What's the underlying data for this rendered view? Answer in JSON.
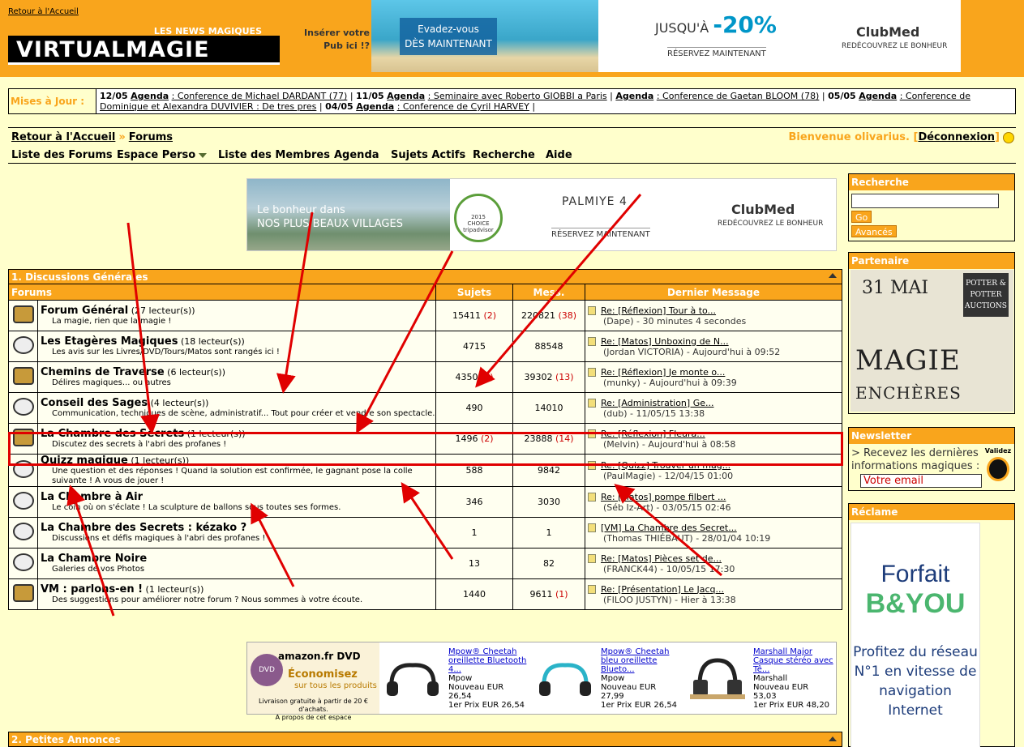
{
  "header": {
    "home_link": "Retour à l'Accueil",
    "logo_tagline": "LES NEWS MAGIQUES",
    "logo_word": "VIRTUALMAGIE",
    "pub_line1": "Insérer votre",
    "pub_line2": "Pub ici !?",
    "ad": {
      "line1": "Evadez-vous",
      "line2": "DÈS MAINTENANT",
      "promo_prefix": "JUSQU'À",
      "promo_value": "-20%",
      "reserve": "RÉSERVEZ MAINTENANT",
      "brand": "ClubMed",
      "brand_sub": "REDÉCOUVREZ LE BONHEUR"
    }
  },
  "updates": {
    "label": "Mises à Jour :",
    "items": [
      {
        "date": "12/05",
        "cat": "Agenda",
        "text": ": Conference de Michael DARDANT (77)"
      },
      {
        "date": "11/05",
        "cat": "Agenda",
        "text": ": Seminaire avec Roberto GIOBBI a Paris"
      },
      {
        "date": "",
        "cat": "Agenda",
        "text": ": Conference de Gaetan BLOOM (78)"
      },
      {
        "date": "05/05",
        "cat": "Agenda",
        "text": ": Conference de Dominique et Alexandra DUVIVIER : De tres pres"
      },
      {
        "date": "04/05",
        "cat": "Agenda",
        "text": ": Conference de Cyril HARVEY"
      }
    ]
  },
  "breadcrumb": {
    "home": "Retour à l'Accueil",
    "sep": "»",
    "forums": "Forums",
    "welcome": "Bienvenue olivarius.",
    "logout": "Déconnexion"
  },
  "menu": [
    "Liste des Forums",
    "Espace Perso",
    "Liste des Membres",
    "Agenda",
    "Sujets Actifs",
    "Recherche",
    "Aide"
  ],
  "mid_ad": {
    "photo_line1": "Le bonheur dans",
    "photo_line2": "NOS PLUS BEAUX VILLAGES",
    "badge": "tripadvisor",
    "badge_top": "2015",
    "badge_mid": "CHOICE",
    "village": "PALMIYE 4",
    "reserve": "RÉSERVEZ MAINTENANT",
    "brand": "ClubMed",
    "brand_sub": "REDÉCOUVREZ LE BONHEUR"
  },
  "forum_table": {
    "category_title": "1. Discussions Générales",
    "columns": [
      "Forums",
      "Sujets",
      "Mess.",
      "Dernier Message"
    ],
    "rows": [
      {
        "title": "Forum Général",
        "readers": "(27 lecteur(s))",
        "desc": "La magie, rien que la magie !",
        "topics": "15411",
        "topics_new": "(2)",
        "posts": "220821",
        "posts_new": "(38)",
        "last_title": "Re: [Réflexion] Tour à to...",
        "last_meta": "(Dape) - 30 minutes 4 secondes",
        "hot": true
      },
      {
        "title": "Les Etagères Magiques",
        "readers": "(18 lecteur(s))",
        "desc": "Les avis sur les Livres/DVD/Tours/Matos sont rangés ici !",
        "topics": "4715",
        "topics_new": "",
        "posts": "88548",
        "posts_new": "",
        "last_title": "Re: [Matos] Unboxing de N...",
        "last_meta": "(Jordan VICTORIA) - Aujourd'hui à 09:52",
        "hot": false
      },
      {
        "title": "Chemins de Traverse",
        "readers": "(6 lecteur(s))",
        "desc": "Délires magiques... ou autres",
        "topics": "4350",
        "topics_new": "(1)",
        "posts": "39302",
        "posts_new": "(13)",
        "last_title": "Re: [Réflexion] Je monte o...",
        "last_meta": "(munky) - Aujourd'hui à 09:39",
        "hot": true
      },
      {
        "title": "Conseil des Sages",
        "readers": "(4 lecteur(s))",
        "desc": "Communication, techniques de scène, administratif... Tout pour créer et vendre son spectacle.",
        "topics": "490",
        "topics_new": "",
        "posts": "14010",
        "posts_new": "",
        "last_title": "Re: [Administration] Ge...",
        "last_meta": "(dub) - 11/05/15 13:38",
        "hot": false
      },
      {
        "title": "La Chambre des Secrets",
        "readers": "(1 lecteur(s))",
        "desc": "Discutez des secrets à l'abri des profanes !",
        "topics": "1496",
        "topics_new": "(2)",
        "posts": "23888",
        "posts_new": "(14)",
        "last_title": "Re: [Réflexion] Fleura...",
        "last_meta": "(Melvin) - Aujourd'hui à 08:58",
        "hot": true
      },
      {
        "title": "Quizz magique",
        "readers": "(1 lecteur(s))",
        "desc": "Une question et des réponses ! Quand la solution est confirmée, le gagnant pose la colle suivante ! A vous de jouer !",
        "topics": "588",
        "topics_new": "",
        "posts": "9842",
        "posts_new": "",
        "last_title": "Re: [Quizz] Trouver un mag...",
        "last_meta": "(PaulMagie) - 12/04/15 01:00",
        "hot": false
      },
      {
        "title": "La Chambre à Air",
        "readers": "",
        "desc": "Le coin où on s'éclate ! La sculpture de ballons sous toutes ses formes.",
        "topics": "346",
        "topics_new": "",
        "posts": "3030",
        "posts_new": "",
        "last_title": "Re: [Matos] pompe filbert ...",
        "last_meta": "(Séb Iz-Art) - 03/05/15 02:46",
        "hot": false
      },
      {
        "title": "La Chambre des Secrets : kézako ?",
        "readers": "",
        "desc": "Discussions et défis magiques à l'abri des profanes !",
        "topics": "1",
        "topics_new": "",
        "posts": "1",
        "posts_new": "",
        "last_title": "[VM] La Chambre des Secret...",
        "last_meta": "(Thomas THIÉBAUT) - 28/01/04 10:19",
        "hot": false
      },
      {
        "title": "La Chambre Noire",
        "readers": "",
        "desc": "Galeries de vos Photos",
        "topics": "13",
        "topics_new": "",
        "posts": "82",
        "posts_new": "",
        "last_title": "Re: [Matos] Pièces set de...",
        "last_meta": "(FRANCK44) - 10/05/15 17:30",
        "hot": false
      },
      {
        "title": "VM : parlons-en !",
        "readers": "(1 lecteur(s))",
        "desc": "Des suggestions pour améliorer notre forum ? Nous sommes à votre écoute.",
        "topics": "1440",
        "topics_new": "",
        "posts": "9611",
        "posts_new": "(1)",
        "last_title": "Re: [Présentation] Le Jacq...",
        "last_meta": "(FILOO JUSTYN) - Hier à 13:38",
        "hot": true
      }
    ]
  },
  "amazon": {
    "logo": "amazon.fr DVD",
    "dvd": "DVD",
    "eco": "Économisez",
    "eco2": "sur tous les produits",
    "fine1": "Livraison gratuite à partir de 20 € d'achats.",
    "fine2": "A propos de cet espace",
    "products": [
      {
        "title": "Mpow® Cheetah oreillette Bluetooth 4...",
        "seller": "Mpow",
        "new_label": "Nouveau EUR",
        "price": "26,54",
        "first": "1er Prix EUR 26,54"
      },
      {
        "title": "Mpow® Cheetah bleu oreillette Blueto...",
        "seller": "Mpow",
        "new_label": "Nouveau EUR",
        "price": "27,99",
        "first": "1er Prix EUR 26,54"
      },
      {
        "title": "Marshall Major Casque stéréo avec Tê...",
        "seller": "Marshall",
        "new_label": "Nouveau EUR",
        "price": "53,03",
        "first": "1er Prix EUR 48,20"
      }
    ]
  },
  "category2": "2. Petites Annonces",
  "sidebar": {
    "search": {
      "title": "Recherche",
      "go": "Go",
      "advanced": "Avancés"
    },
    "partner": {
      "title": "Partenaire",
      "date": "31 MAI",
      "logo": "POTTER & POTTER AUCTIONS",
      "word1": "MAGIE",
      "word2": "ENCHÈRES"
    },
    "newsletter": {
      "title": "Newsletter",
      "text": "> Recevez les dernières informations magiques :",
      "email_placeholder": "Votre email",
      "validate": "Validez"
    },
    "reclame": {
      "title": "Réclame",
      "line1": "Forfait",
      "line2": "B&YOU",
      "line3": "Profitez du réseau N°1 en vitesse de navigation Internet"
    }
  },
  "colors": {
    "orange": "#F9A51C",
    "bg": "#FFFFCC",
    "red_annotation": "#e00000"
  }
}
